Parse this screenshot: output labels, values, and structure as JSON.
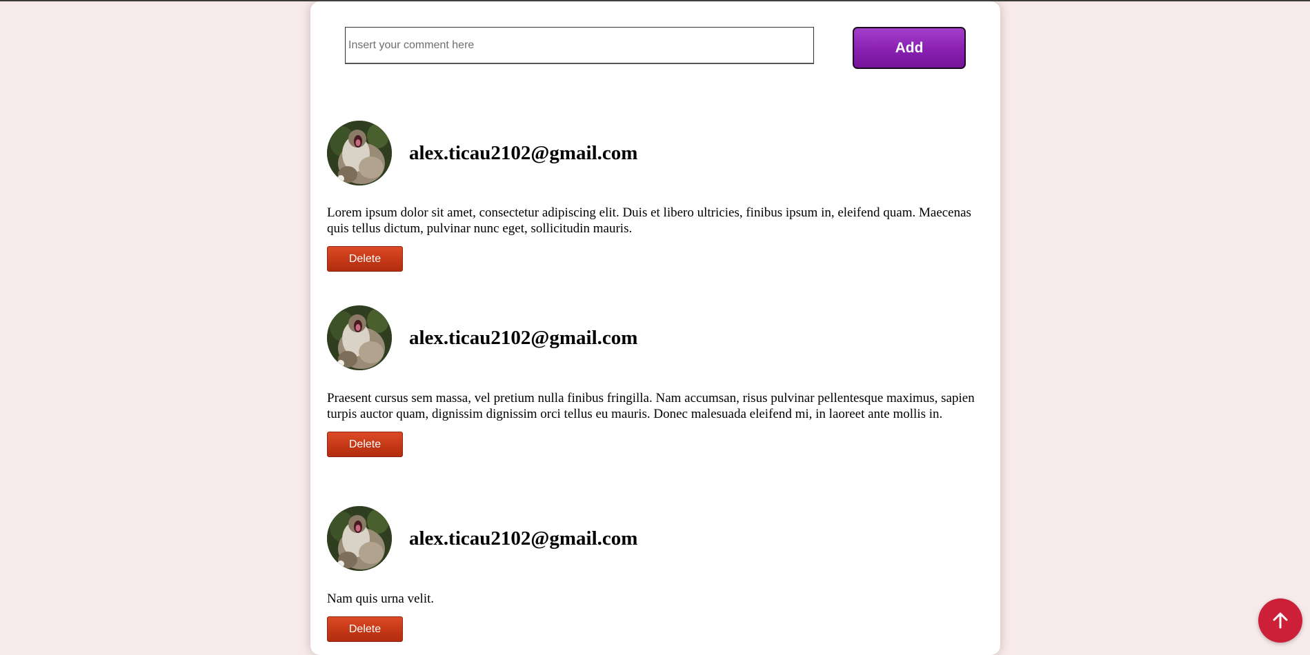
{
  "form": {
    "placeholder": "Insert your comment here",
    "value": "",
    "add_label": "Add"
  },
  "comments": [
    {
      "author": "alex.ticau2102@gmail.com",
      "text": "Lorem ipsum dolor sit amet, consectetur adipiscing elit. Duis et libero ultricies, finibus ipsum in, eleifend quam. Maecenas quis tellus dictum, pulvinar nunc eget, sollicitudin mauris.",
      "delete_label": "Delete"
    },
    {
      "author": "alex.ticau2102@gmail.com",
      "text": "Praesent cursus sem massa, vel pretium nulla finibus fringilla. Nam accumsan, risus pulvinar pellentesque maximus, sapien turpis auctor quam, dignissim dignissim orci tellus eu mauris. Donec malesuada eleifend mi, in laoreet ante mollis in.",
      "delete_label": "Delete"
    },
    {
      "author": "alex.ticau2102@gmail.com",
      "text": "Nam quis urna velit.",
      "delete_label": "Delete"
    }
  ],
  "icons": {
    "avatar": "cat-photo",
    "scroll_top": "arrow-up-icon"
  },
  "colors": {
    "page_background": "#f7eaea",
    "add_button": "#8a1fb2",
    "delete_button": "#c23715",
    "scroll_top_button": "#cc1f38"
  }
}
